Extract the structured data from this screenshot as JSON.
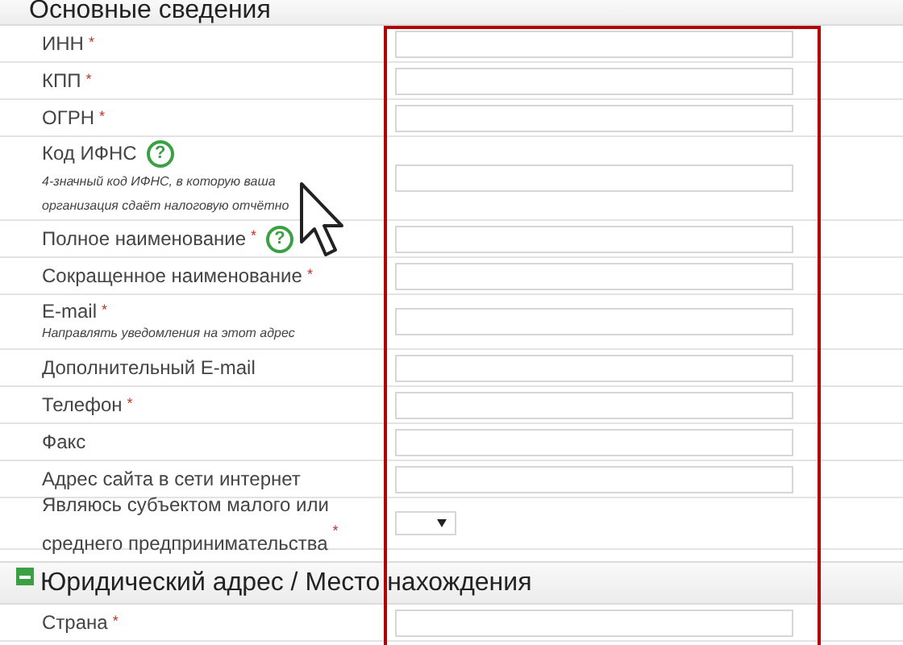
{
  "required_mark": "*",
  "sections": [
    {
      "title": "Основные сведения",
      "fields": [
        {
          "kind": "text",
          "label": "ИНН",
          "required": true
        },
        {
          "kind": "text",
          "label": "КПП",
          "required": true
        },
        {
          "kind": "text",
          "label": "ОГРН",
          "required": true
        },
        {
          "kind": "text",
          "label": "Код ИФНС",
          "required": false,
          "help": "?",
          "hint": "4-значный код ИФНС, в которую ваша организация сдаёт налоговую отчётно"
        },
        {
          "kind": "text",
          "label": "Полное наименование",
          "required": true,
          "help": "?"
        },
        {
          "kind": "text",
          "label": "Сокращенное наименование",
          "required": true
        },
        {
          "kind": "text",
          "label": "E-mail",
          "required": true,
          "hint": "Направлять уведомления на этот адрес"
        },
        {
          "kind": "text",
          "label": "Дополнительный E-mail",
          "required": false
        },
        {
          "kind": "text",
          "label": "Телефон",
          "required": true
        },
        {
          "kind": "text",
          "label": "Факс",
          "required": false
        },
        {
          "kind": "text",
          "label": "Адрес сайта в сети интернет",
          "required": false
        },
        {
          "kind": "select",
          "label": "Являюсь субъектом малого или среднего предпринимательства",
          "required": true
        }
      ]
    },
    {
      "title": "Юридический адрес / Место нахождения",
      "expanded": true,
      "fields": [
        {
          "kind": "text",
          "label": "Страна",
          "required": true
        }
      ]
    }
  ]
}
